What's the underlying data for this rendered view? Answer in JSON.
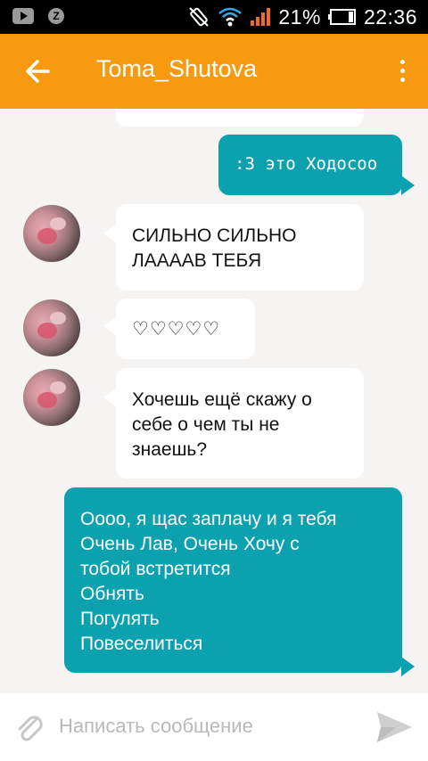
{
  "status_bar": {
    "battery_percent": "21%",
    "time": "22:36"
  },
  "header": {
    "title": "Toma_Shutova"
  },
  "messages": [
    {
      "direction": "out",
      "text": ":3 это Ходосоо"
    },
    {
      "direction": "in",
      "text": "СИЛЬНО СИЛЬНО\nЛААААВ ТЕБЯ"
    },
    {
      "direction": "in",
      "text": "♡♡♡♡♡"
    },
    {
      "direction": "in",
      "text": "Хочешь ещё скажу о\nсебе о чем ты не\nзнаешь?"
    },
    {
      "direction": "out",
      "text": "Оооо, я щас заплачу и я тебя\nОчень Лав, Очень Хочу с\nтобой встретится\nОбнять\nПогулять\nПовеселиться"
    }
  ],
  "composer": {
    "placeholder": "Написать сообщение"
  },
  "colors": {
    "toolbar": "#f89a10",
    "outgoing_bubble": "#0ba1ae",
    "incoming_bubble": "#ffffff",
    "background": "#f6f4f2"
  },
  "icons": {
    "back": "arrow-left-icon",
    "menu": "more-vertical-icon",
    "attach": "paperclip-icon",
    "send": "send-icon"
  }
}
